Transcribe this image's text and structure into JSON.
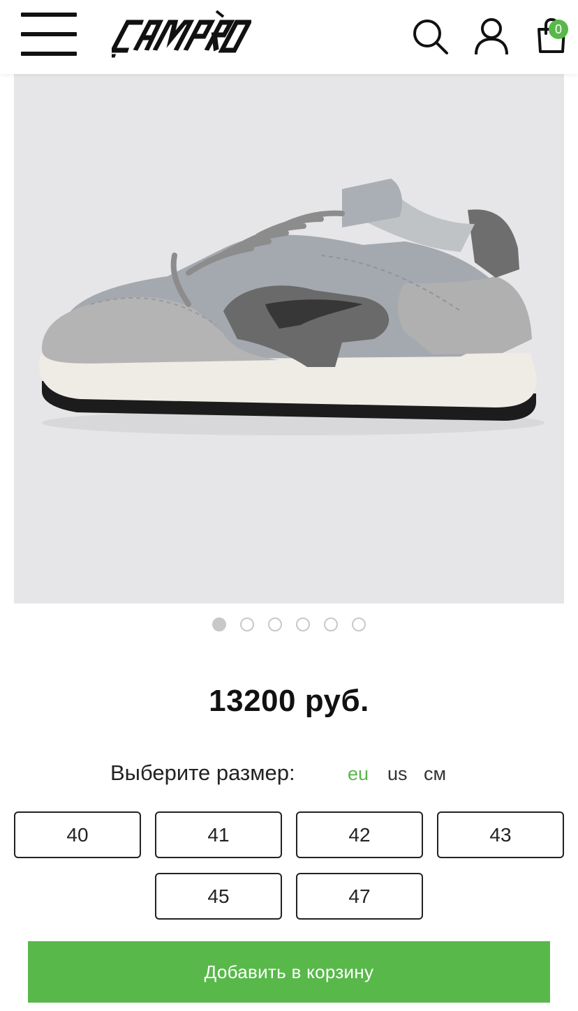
{
  "header": {
    "logo_text": "CAMPRO",
    "cart_count": "0"
  },
  "gallery": {
    "total_images": 6,
    "active_index": 0
  },
  "product": {
    "price": "13200 руб."
  },
  "size_selector": {
    "label": "Выберите размер:",
    "units": [
      {
        "label": "eu",
        "active": true
      },
      {
        "label": "us",
        "active": false
      },
      {
        "label": "см",
        "active": false
      }
    ],
    "sizes": [
      "40",
      "41",
      "42",
      "43",
      "45",
      "47"
    ]
  },
  "actions": {
    "add_to_cart": "Добавить в корзину"
  },
  "colors": {
    "accent": "#58b84a",
    "image_background": "#e6e6e8"
  }
}
